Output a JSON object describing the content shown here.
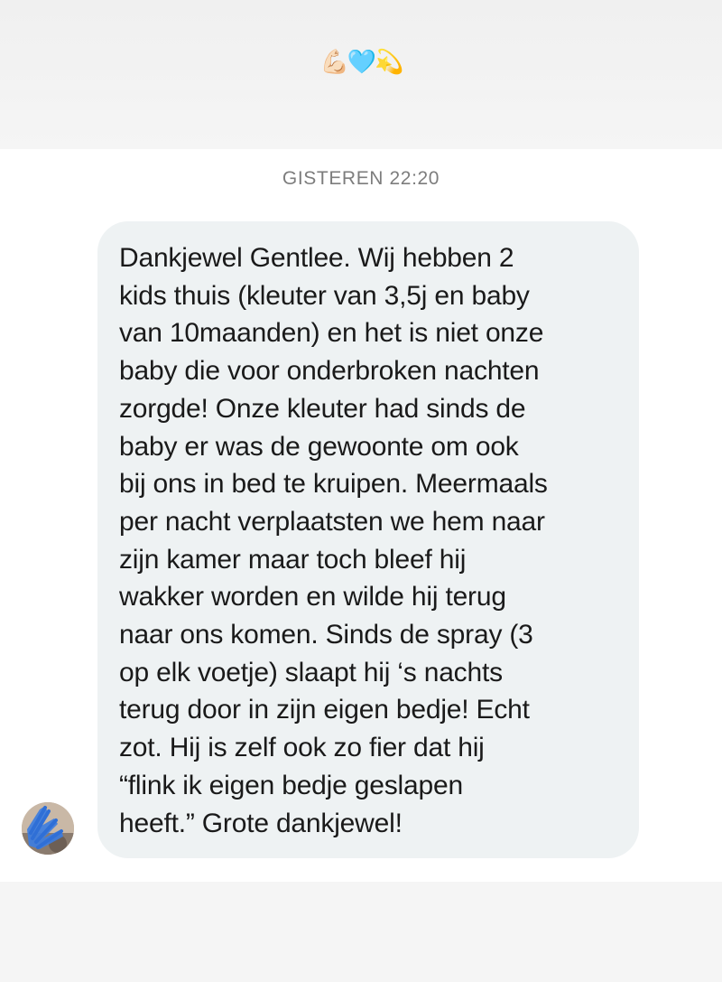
{
  "header": {
    "reaction_emojis": [
      "💪🏻",
      "🩵",
      "💫"
    ]
  },
  "chat": {
    "timestamp": "GISTEREN 22:20",
    "message": {
      "text": "Dankjewel Gentlee. Wij hebben 2\nkids thuis (kleuter van 3,5j en baby\nvan 10maanden) en het is niet onze\nbaby die voor onderbroken nachten\nzorgde! Onze kleuter had sinds de\nbaby er was de gewoonte om ook\nbij ons in bed te kruipen. Meermaals\nper nacht verplaatsten we hem naar\nzijn kamer maar toch bleef hij\nwakker worden en wilde hij terug\nnaar ons komen. Sinds de spray (3\nop elk voetje) slaapt hij ‘s nachts\nterug door in zijn eigen bedje! Echt\nzot. Hij is zelf ook zo fier dat hij\n“flink ik eigen bedje geslapen\nheeft.” Grote dankjewel!"
    },
    "sender_avatar": "blurred-profile-photo"
  },
  "colors": {
    "bubble": "#eef2f3",
    "timestamp": "#7d7d7d",
    "text": "#1a1a1a",
    "avatar_scribble": "#3d7de0"
  }
}
